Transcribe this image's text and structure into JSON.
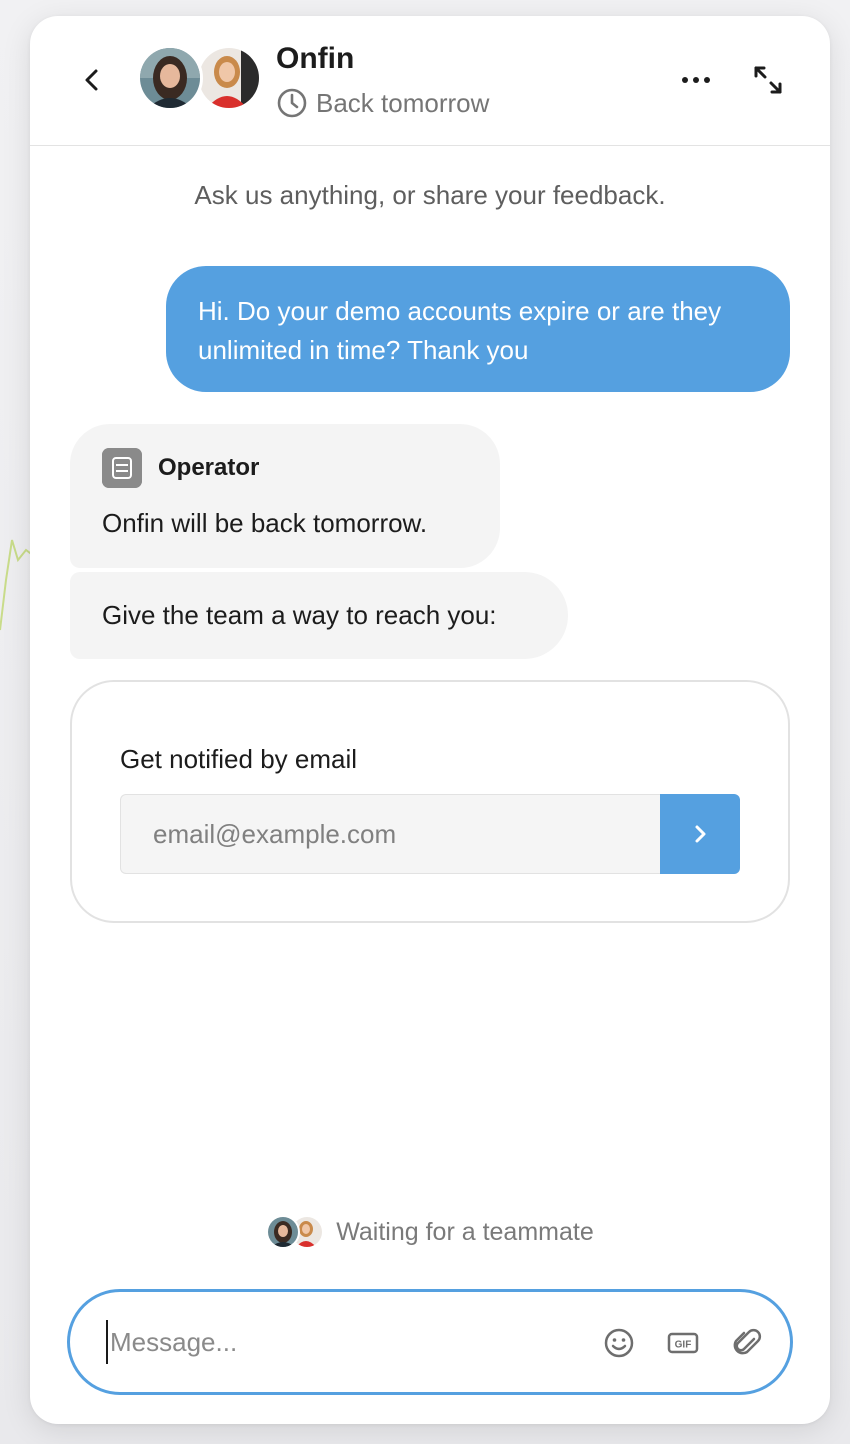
{
  "header": {
    "back_icon": "chevron-left-icon",
    "team_name": "Onfin",
    "status_icon": "clock-icon",
    "status_text": "Back tomorrow",
    "more_icon": "more-horizontal-icon",
    "expand_icon": "expand-icon"
  },
  "conversation": {
    "intro": "Ask us anything, or share your feedback.",
    "user_message": "Hi. Do your demo accounts expire or are they unlimited in time? Thank you",
    "operator": {
      "name": "Operator",
      "icon": "operator-bot-icon",
      "message1": "Onfin will be back tomorrow.",
      "message2": "Give the team a way to reach you:"
    },
    "notify_card": {
      "title": "Get notified by email",
      "email_placeholder": "email@example.com",
      "email_value": "",
      "submit_icon": "chevron-right-icon"
    },
    "waiting_text": "Waiting for a teammate"
  },
  "composer": {
    "placeholder": "Message...",
    "value": "",
    "emoji_icon": "emoji-icon",
    "gif_icon": "gif-icon",
    "attach_icon": "paperclip-icon"
  },
  "colors": {
    "accent": "#55a0e0",
    "bubble_gray": "#f4f4f4",
    "muted_text": "#757575"
  }
}
